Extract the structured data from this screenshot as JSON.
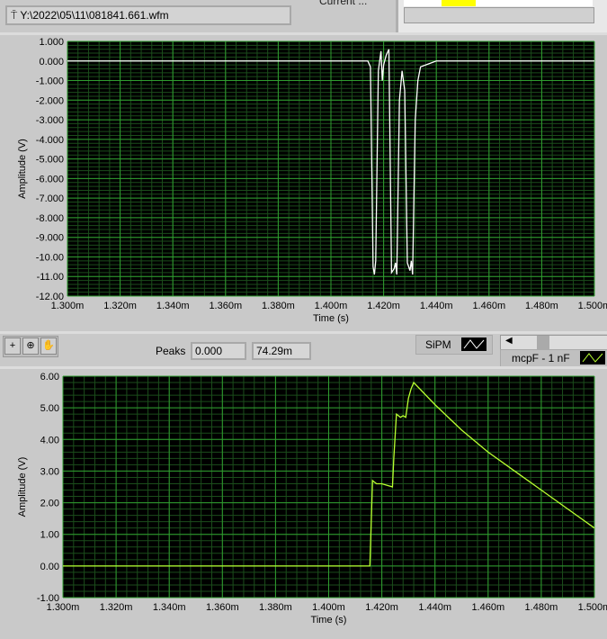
{
  "file_path": "Y:\\2022\\05\\11\\081841.661.wfm",
  "current_label": "Current ...",
  "peaks": {
    "label": "Peaks",
    "value1": "0.000",
    "value2": "74.29m"
  },
  "legend": {
    "plot1": "SiPM",
    "plot2": "mcpF - 1 nF"
  },
  "colors": {
    "trace1": "#ffffff",
    "trace2": "#b8ff30",
    "grid_major": "#2f9d2f",
    "grid_minor": "#1b4d1b"
  },
  "chart_data": [
    {
      "type": "line",
      "title": "",
      "xlabel": "Time (s)",
      "ylabel": "Amplitude (V)",
      "xlim": [
        1.3,
        1.5
      ],
      "ylim": [
        -12,
        1
      ],
      "xticks": [
        "1.300m",
        "1.320m",
        "1.340m",
        "1.360m",
        "1.380m",
        "1.400m",
        "1.420m",
        "1.440m",
        "1.460m",
        "1.480m",
        "1.500m"
      ],
      "yticks": [
        "1.000",
        "0.000",
        "-1.000",
        "-2.000",
        "-3.000",
        "-4.000",
        "-5.000",
        "-6.000",
        "-7.000",
        "-8.000",
        "-9.000",
        "-10.00",
        "-11.00",
        "-12.00"
      ],
      "series": [
        {
          "name": "SiPM",
          "x": [
            1.3,
            1.414,
            1.415,
            1.416,
            1.4165,
            1.417,
            1.418,
            1.419,
            1.4195,
            1.42,
            1.421,
            1.422,
            1.423,
            1.424,
            1.4245,
            1.425,
            1.426,
            1.427,
            1.428,
            1.429,
            1.43,
            1.4305,
            1.431,
            1.432,
            1.433,
            1.434,
            1.436,
            1.44,
            1.5
          ],
          "y": [
            0,
            0,
            -0.3,
            -10.5,
            -10.9,
            -10.2,
            -0.5,
            0.5,
            -1,
            -0.2,
            0.3,
            0.6,
            -10.8,
            -10.6,
            -10.3,
            -10.9,
            -2,
            -0.5,
            -1.5,
            -10.3,
            -10.7,
            -10.2,
            -10.9,
            -3,
            -1,
            -0.3,
            -0.2,
            0,
            0
          ]
        }
      ]
    },
    {
      "type": "line",
      "title": "",
      "xlabel": "Time (s)",
      "ylabel": "Amplitude (V)",
      "xlim": [
        1.3,
        1.5
      ],
      "ylim": [
        -1,
        6
      ],
      "xticks": [
        "1.300m",
        "1.320m",
        "1.340m",
        "1.360m",
        "1.380m",
        "1.400m",
        "1.420m",
        "1.440m",
        "1.460m",
        "1.480m",
        "1.500m"
      ],
      "yticks": [
        "6.00",
        "5.00",
        "4.00",
        "3.00",
        "2.00",
        "1.00",
        "0.00",
        "-1.00"
      ],
      "series": [
        {
          "name": "mcpF - 1 nF",
          "x": [
            1.3,
            1.4155,
            1.4165,
            1.418,
            1.42,
            1.422,
            1.424,
            1.4245,
            1.4255,
            1.427,
            1.428,
            1.429,
            1.43,
            1.431,
            1.432,
            1.44,
            1.45,
            1.46,
            1.47,
            1.48,
            1.49,
            1.5
          ],
          "y": [
            0,
            0,
            2.7,
            2.6,
            2.6,
            2.55,
            2.5,
            3.4,
            4.8,
            4.7,
            4.75,
            4.7,
            5.3,
            5.6,
            5.8,
            5.1,
            4.3,
            3.6,
            3.0,
            2.4,
            1.8,
            1.2
          ]
        }
      ]
    }
  ]
}
